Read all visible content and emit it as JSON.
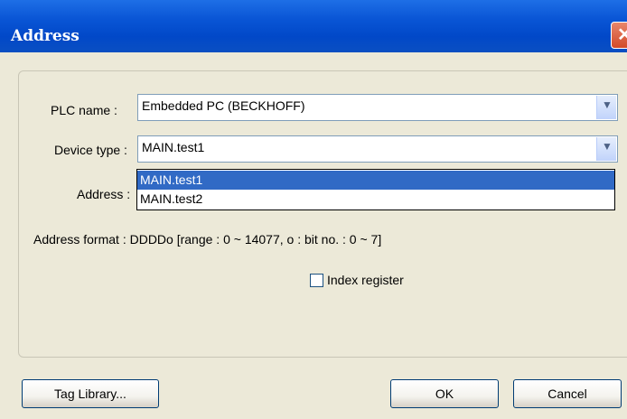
{
  "window": {
    "title": "Address",
    "close_icon": "close-icon"
  },
  "form": {
    "plc_label": "PLC name :",
    "plc_value": "Embedded PC (BECKHOFF)",
    "device_label": "Device type :",
    "device_value": "MAIN.test1",
    "device_options": [
      "MAIN.test1",
      "MAIN.test2"
    ],
    "address_label": "Address :",
    "address_format": "Address format : DDDDo [range : 0 ~ 14077, o : bit no. : 0 ~ 7]",
    "index_register_label": "Index register",
    "index_register_checked": false
  },
  "buttons": {
    "tag_library": "Tag Library...",
    "ok": "OK",
    "cancel": "Cancel"
  },
  "colors": {
    "titlebar": "#0a56d6",
    "selection": "#316ac5",
    "dialog_bg": "#ece9d8"
  }
}
